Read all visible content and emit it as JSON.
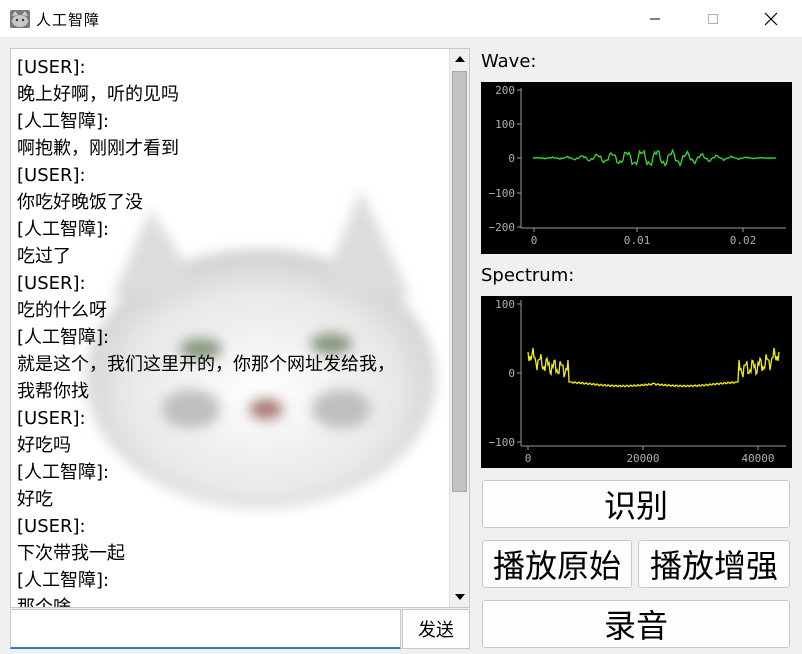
{
  "window": {
    "title": "人工智障",
    "icons": {
      "app": "cat-app-icon",
      "minimize": "minimize-icon",
      "maximize": "maximize-icon",
      "close": "close-icon"
    }
  },
  "chat": {
    "messages": [
      {
        "speaker": "[USER]:",
        "text": "晚上好啊，听的见吗"
      },
      {
        "speaker": "[人工智障]:",
        "text": "啊抱歉，刚刚才看到"
      },
      {
        "speaker": "[USER]:",
        "text": "你吃好晚饭了没"
      },
      {
        "speaker": "[人工智障]:",
        "text": "吃过了"
      },
      {
        "speaker": "[USER]:",
        "text": "吃的什么呀"
      },
      {
        "speaker": "[人工智障]:",
        "text": "就是这个，我们这里开的，你那个网址发给我，\n我帮你找"
      },
      {
        "speaker": "[USER]:",
        "text": "好吃吗"
      },
      {
        "speaker": "[人工智障]:",
        "text": "好吃"
      },
      {
        "speaker": "[USER]:",
        "text": "下次带我一起"
      },
      {
        "speaker": "[人工智障]:",
        "text": "那个啥"
      }
    ],
    "input_value": "",
    "send_label": "发送"
  },
  "wave": {
    "label": "Wave:",
    "y_ticks": [
      "200",
      "100",
      "0",
      "−100",
      "−200"
    ],
    "x_ticks": [
      "0",
      "0.01",
      "0.02"
    ],
    "line_color": "#33dd33"
  },
  "spectrum": {
    "label": "Spectrum:",
    "y_ticks": [
      "100",
      "0",
      "−100"
    ],
    "x_ticks": [
      "0",
      "20000",
      "40000"
    ],
    "line_color": "#f0f000"
  },
  "buttons": {
    "recognize": "识别",
    "play_original": "播放原始",
    "play_enhanced": "播放增强",
    "record": "录音"
  }
}
